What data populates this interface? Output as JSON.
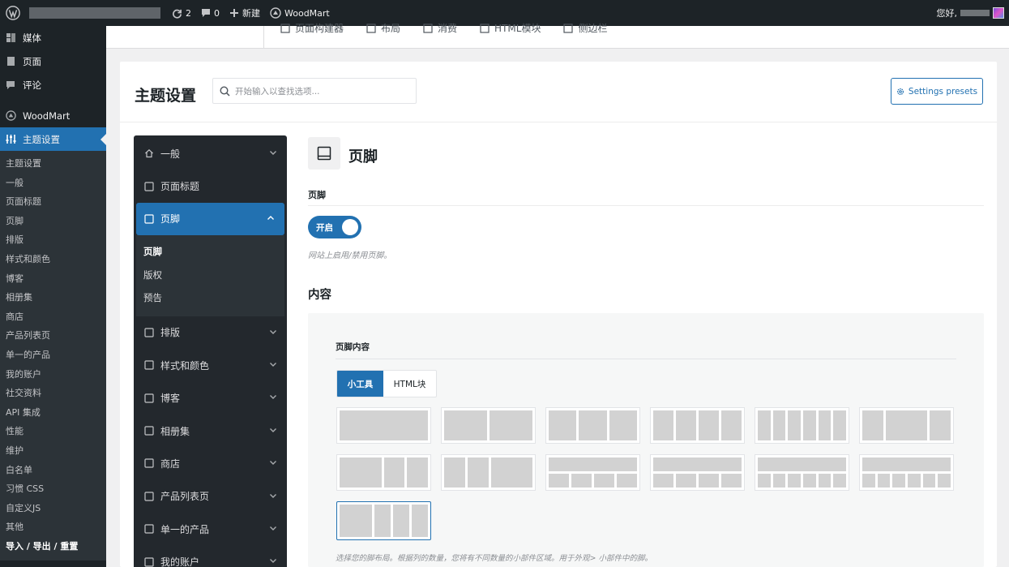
{
  "admin_bar": {
    "comments_updates_count": "2",
    "comments_count": "0",
    "new_label": "新建",
    "plugin_label": "WoodMart",
    "greeting": "您好,"
  },
  "sidebar": {
    "items_top": [
      {
        "label": "媒体",
        "icon": "media-icon"
      },
      {
        "label": "页面",
        "icon": "page-icon"
      },
      {
        "label": "评论",
        "icon": "comment-icon"
      }
    ],
    "woodmart": {
      "label": "WoodMart",
      "icon": "woodmart-icon"
    },
    "theme_settings": {
      "label": "主题设置",
      "icon": "sliders-icon"
    },
    "submenu": [
      "主题设置",
      "一般",
      "页面标题",
      "页脚",
      "排版",
      "样式和颜色",
      "博客",
      "相册集",
      "商店",
      "产品列表页",
      "单一的产品",
      "我的账户",
      "社交资料",
      "API 集成",
      "性能",
      "维护",
      "白名单",
      "习惯 CSS",
      "自定义JS",
      "其他",
      "导入 / 导出 / 重置"
    ]
  },
  "top_tabs": [
    "页面构建器",
    "布局",
    "消费",
    "HTML模块",
    "侧边栏"
  ],
  "settings": {
    "title": "主题设置",
    "search_placeholder": "开始输入以查找选项...",
    "presets_button": "Settings presets"
  },
  "options_nav": {
    "before": [
      {
        "label": "一般",
        "icon": "home-icon",
        "chevron": true
      },
      {
        "label": "页面标题",
        "icon": "title-icon",
        "chevron": false
      }
    ],
    "active": {
      "label": "页脚",
      "icon": "footer-icon"
    },
    "sub": [
      "页脚",
      "版权",
      "预告"
    ],
    "after": [
      {
        "label": "排版",
        "icon": "typography-icon"
      },
      {
        "label": "样式和颜色",
        "icon": "brush-icon"
      },
      {
        "label": "博客",
        "icon": "blog-icon"
      },
      {
        "label": "相册集",
        "icon": "portfolio-icon"
      },
      {
        "label": "商店",
        "icon": "cart-icon"
      },
      {
        "label": "产品列表页",
        "icon": "archive-icon"
      },
      {
        "label": "单一的产品",
        "icon": "bag-icon"
      },
      {
        "label": "我的账户",
        "icon": "account-icon"
      }
    ]
  },
  "footer_section": {
    "title": "页脚",
    "toggle_label": "页脚",
    "toggle_state": "开启",
    "toggle_desc": "网站上启用/禁用页脚。",
    "content_heading": "内容",
    "layout_label": "页脚内容",
    "tabs": [
      "小工具",
      "HTML块"
    ],
    "layout_desc": "选择您的脚布局。根据列的数量，您将有不同数量的小部件区域。用于外观> 小部件中的脚。",
    "layouts": [
      [
        [
          1
        ]
      ],
      [
        [
          1,
          1
        ]
      ],
      [
        [
          1,
          1,
          1
        ]
      ],
      [
        [
          1,
          1,
          1,
          1
        ]
      ],
      [
        [
          1,
          1,
          1,
          1,
          1,
          1
        ]
      ],
      [
        [
          1,
          2,
          1
        ]
      ],
      [
        [
          2,
          1,
          1
        ]
      ],
      [
        [
          1,
          1,
          2
        ]
      ],
      [
        [
          1
        ],
        [
          1,
          1,
          1,
          1
        ]
      ],
      [
        [
          1
        ],
        [
          1,
          1,
          1,
          1
        ]
      ],
      [
        [
          1
        ],
        [
          1,
          1,
          1,
          1,
          1,
          1
        ]
      ],
      [
        [
          1
        ],
        [
          1,
          1,
          1,
          1,
          1,
          1
        ]
      ],
      [
        [
          2,
          1,
          1,
          1
        ]
      ]
    ],
    "selected_layout": 12
  }
}
